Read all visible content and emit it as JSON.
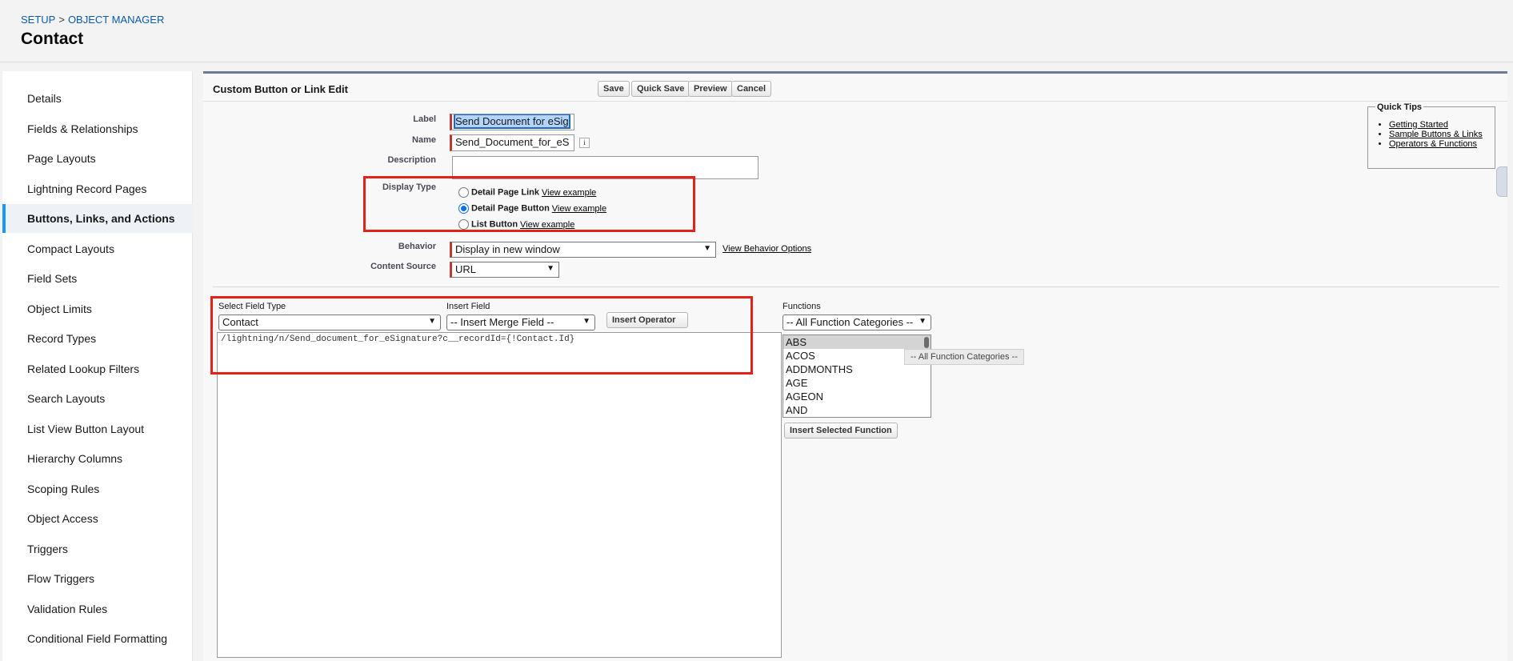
{
  "header": {
    "breadcrumb": [
      "SETUP",
      "OBJECT MANAGER"
    ],
    "breadcrumb_sep": ">",
    "title": "Contact"
  },
  "sidebar": {
    "items": [
      {
        "label": "Details"
      },
      {
        "label": "Fields & Relationships"
      },
      {
        "label": "Page Layouts"
      },
      {
        "label": "Lightning Record Pages"
      },
      {
        "label": "Buttons, Links, and Actions",
        "active": true
      },
      {
        "label": "Compact Layouts"
      },
      {
        "label": "Field Sets"
      },
      {
        "label": "Object Limits"
      },
      {
        "label": "Record Types"
      },
      {
        "label": "Related Lookup Filters"
      },
      {
        "label": "Search Layouts"
      },
      {
        "label": "List View Button Layout"
      },
      {
        "label": "Hierarchy Columns"
      },
      {
        "label": "Scoping Rules"
      },
      {
        "label": "Object Access"
      },
      {
        "label": "Triggers"
      },
      {
        "label": "Flow Triggers"
      },
      {
        "label": "Validation Rules"
      },
      {
        "label": "Conditional Field Formatting"
      }
    ]
  },
  "form": {
    "title": "Custom Button or Link Edit",
    "buttons": {
      "save": "Save",
      "quick_save": "Quick Save",
      "preview": "Preview",
      "cancel": "Cancel"
    },
    "label": {
      "label": "Label",
      "value": "Send Document for eSig"
    },
    "name": {
      "label": "Name",
      "value": "Send_Document_for_eS",
      "info": "i"
    },
    "description": {
      "label": "Description",
      "value": ""
    },
    "display_type": {
      "label": "Display Type",
      "view_example": "View example",
      "options": [
        {
          "label": "Detail Page Link",
          "checked": false
        },
        {
          "label": "Detail Page Button",
          "checked": true
        },
        {
          "label": "List Button",
          "checked": false
        }
      ]
    },
    "behavior": {
      "label": "Behavior",
      "value": "Display in new window",
      "link": "View Behavior Options"
    },
    "content_source": {
      "label": "Content Source",
      "value": "URL"
    },
    "select_field_type": {
      "label": "Select Field Type",
      "value": "Contact"
    },
    "insert_field": {
      "label": "Insert Field",
      "value": "-- Insert Merge Field --"
    },
    "insert_operator": {
      "label": "Insert Operator"
    },
    "formula": "/lightning/n/Send_document_for_eSignature?c__recordId={!Contact.Id}",
    "functions": {
      "label": "Functions",
      "category": "-- All Function Categories --",
      "items": [
        "ABS",
        "ACOS",
        "ADDMONTHS",
        "AGE",
        "AGEON",
        "AND"
      ],
      "selected": "ABS",
      "insert_button": "Insert Selected Function",
      "tooltip": "-- All Function Categories --"
    }
  },
  "quick_tips": {
    "title": "Quick Tips",
    "links": [
      "Getting Started",
      "Sample Buttons & Links",
      "Operators & Functions"
    ]
  },
  "colors": {
    "annotation": "#e4221a",
    "link": "#0b5cab",
    "active_accent": "#1b96ff",
    "required": "#c23934"
  }
}
